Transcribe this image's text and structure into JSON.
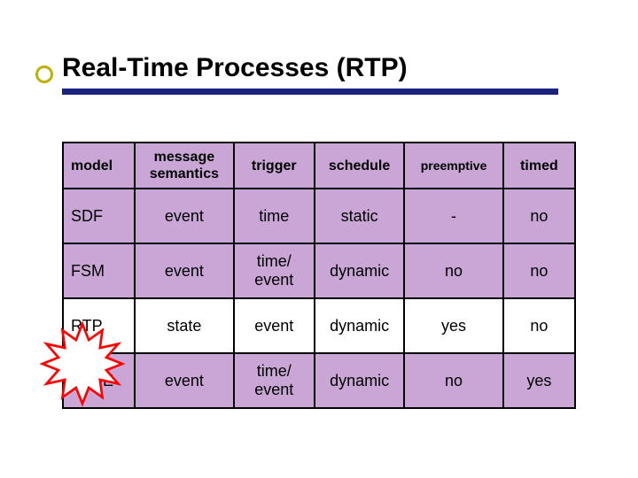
{
  "title": "Real-Time Processes (RTP)",
  "table": {
    "headers": {
      "model": "model",
      "message_semantics": "message semantics",
      "trigger": "trigger",
      "schedule": "schedule",
      "preemptive": "preemptive",
      "timed": "timed"
    },
    "rows": [
      {
        "model": "SDF",
        "msg": "event",
        "trigger": "time",
        "schedule": "static",
        "preemptive": "-",
        "timed": "no"
      },
      {
        "model": "FSM",
        "msg": "event",
        "trigger": "time/ event",
        "schedule": "dynamic",
        "preemptive": "no",
        "timed": "no"
      },
      {
        "model": "RTP",
        "msg": "state",
        "trigger": "event",
        "schedule": "dynamic",
        "preemptive": "yes",
        "timed": "no"
      },
      {
        "model": "TSDE",
        "msg": "event",
        "trigger": "time/ event",
        "schedule": "dynamic",
        "preemptive": "no",
        "timed": "yes"
      }
    ]
  },
  "chart_data": {
    "type": "table",
    "title": "Real-Time Processes (RTP)",
    "columns": [
      "model",
      "message semantics",
      "trigger",
      "schedule",
      "preemptive",
      "timed"
    ],
    "rows": [
      [
        "SDF",
        "event",
        "time",
        "static",
        "-",
        "no"
      ],
      [
        "FSM",
        "event",
        "time/ event",
        "dynamic",
        "no",
        "no"
      ],
      [
        "RTP",
        "state",
        "event",
        "dynamic",
        "yes",
        "no"
      ],
      [
        "TSDE",
        "event",
        "time/ event",
        "dynamic",
        "no",
        "yes"
      ]
    ],
    "highlight_row_index": 2
  },
  "colors": {
    "title_underline": "#1a237e",
    "cell_fill": "#c9a6d6",
    "highlight_fill": "#ffffff",
    "starburst_stroke": "#ff0000",
    "bullet_ring": "#c0b000"
  }
}
